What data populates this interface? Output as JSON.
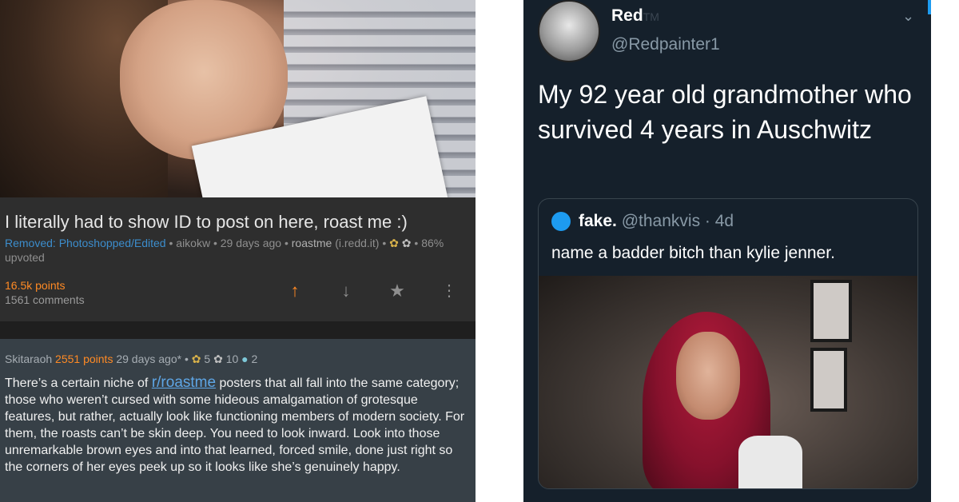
{
  "reddit": {
    "post": {
      "title": "I literally had to show ID to post on here, roast me :)",
      "status": "Removed: Photoshopped/Edited",
      "separator": "•",
      "author": "aikokw",
      "age": "29 days ago",
      "subreddit": "roastme",
      "domain": "(i.redd.it)",
      "upvote_pct": "86%",
      "upvoted_label": "upvoted",
      "points": "16.5k points",
      "comments": "1561 comments"
    },
    "actions": {
      "upvote_icon": "arrow-up-icon",
      "downvote_icon": "arrow-down-icon",
      "save_icon": "star-icon",
      "more_icon": "more-vertical-icon"
    },
    "comment": {
      "author": "Skitaraoh",
      "points": "2551 points",
      "age": "29 days ago*",
      "separator": "•",
      "silver": "5",
      "gold": "10",
      "platinum": "2",
      "body_before": "There’s a certain niche of ",
      "link": "r/roastme",
      "body_after": " posters that all fall into the same category; those who weren’t cursed with some hideous amalgamation of grotesque features, but rather, actually look like functioning members of modern society. For them, the roasts can’t be skin deep. You need to look inward. Look into those unremarkable brown eyes and into that learned, forced smile, done just right so the corners of her eyes peek up so it looks like she’s genuinely happy."
    },
    "colors": {
      "accent": "#ff8a24",
      "link": "#3c8dcc",
      "comment_bg": "#374047"
    }
  },
  "twitter": {
    "name": "Red",
    "tm": "TM",
    "handle": "@Redpainter1",
    "tweet": "My 92 year old grandmother who survived 4 years in Auschwitz",
    "quote": {
      "name": "fake.",
      "handle": "@thankvis · 4d",
      "text": "name a badder bitch than kylie jenner."
    },
    "colors": {
      "bg": "#15202b",
      "accent": "#1d9bf0"
    }
  }
}
